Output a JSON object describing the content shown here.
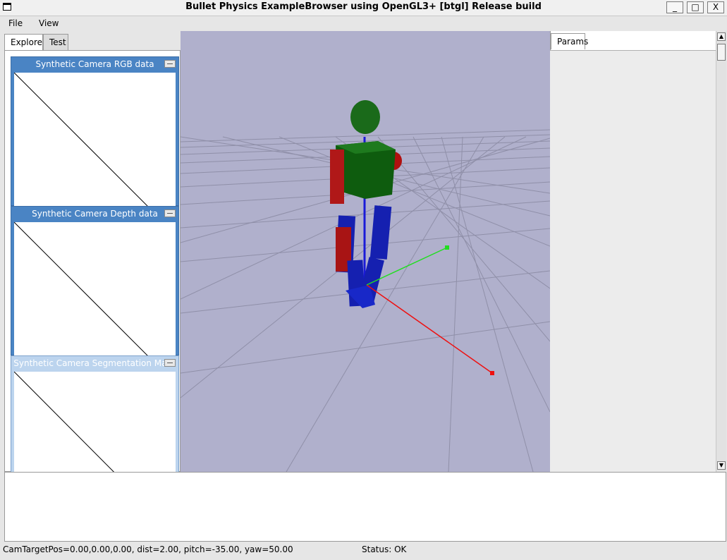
{
  "window": {
    "title": "Bullet Physics ExampleBrowser using OpenGL3+ [btgl] Release build",
    "minimize_label": "_",
    "maximize_label": "□",
    "close_label": "X"
  },
  "menu": {
    "file": "File",
    "view": "View"
  },
  "left_tabs": [
    {
      "label": "Explorer"
    },
    {
      "label": "Test"
    }
  ],
  "right_tabs": [
    {
      "label": "Params"
    }
  ],
  "camera_windows": [
    {
      "title": "Synthetic Camera RGB data"
    },
    {
      "title": "Synthetic Camera Depth data"
    },
    {
      "title": "Synthetic Camera Segmentation Mask"
    }
  ],
  "status": {
    "camera": "CamTargetPos=0.00,0.00,0.00, dist=2.00, pitch=-35.00, yaw=50.00",
    "state": "Status: OK"
  },
  "colors": {
    "viewport_bg": "#b0b0cc",
    "camera_title_bg": "#4a84c4",
    "axis_x": "#ff0000",
    "axis_y": "#00cc00",
    "axis_z": "#0000ff"
  },
  "icons": {
    "app": "window-icon",
    "minimize": "minimize-icon",
    "maximize": "maximize-icon",
    "close": "close-icon"
  }
}
